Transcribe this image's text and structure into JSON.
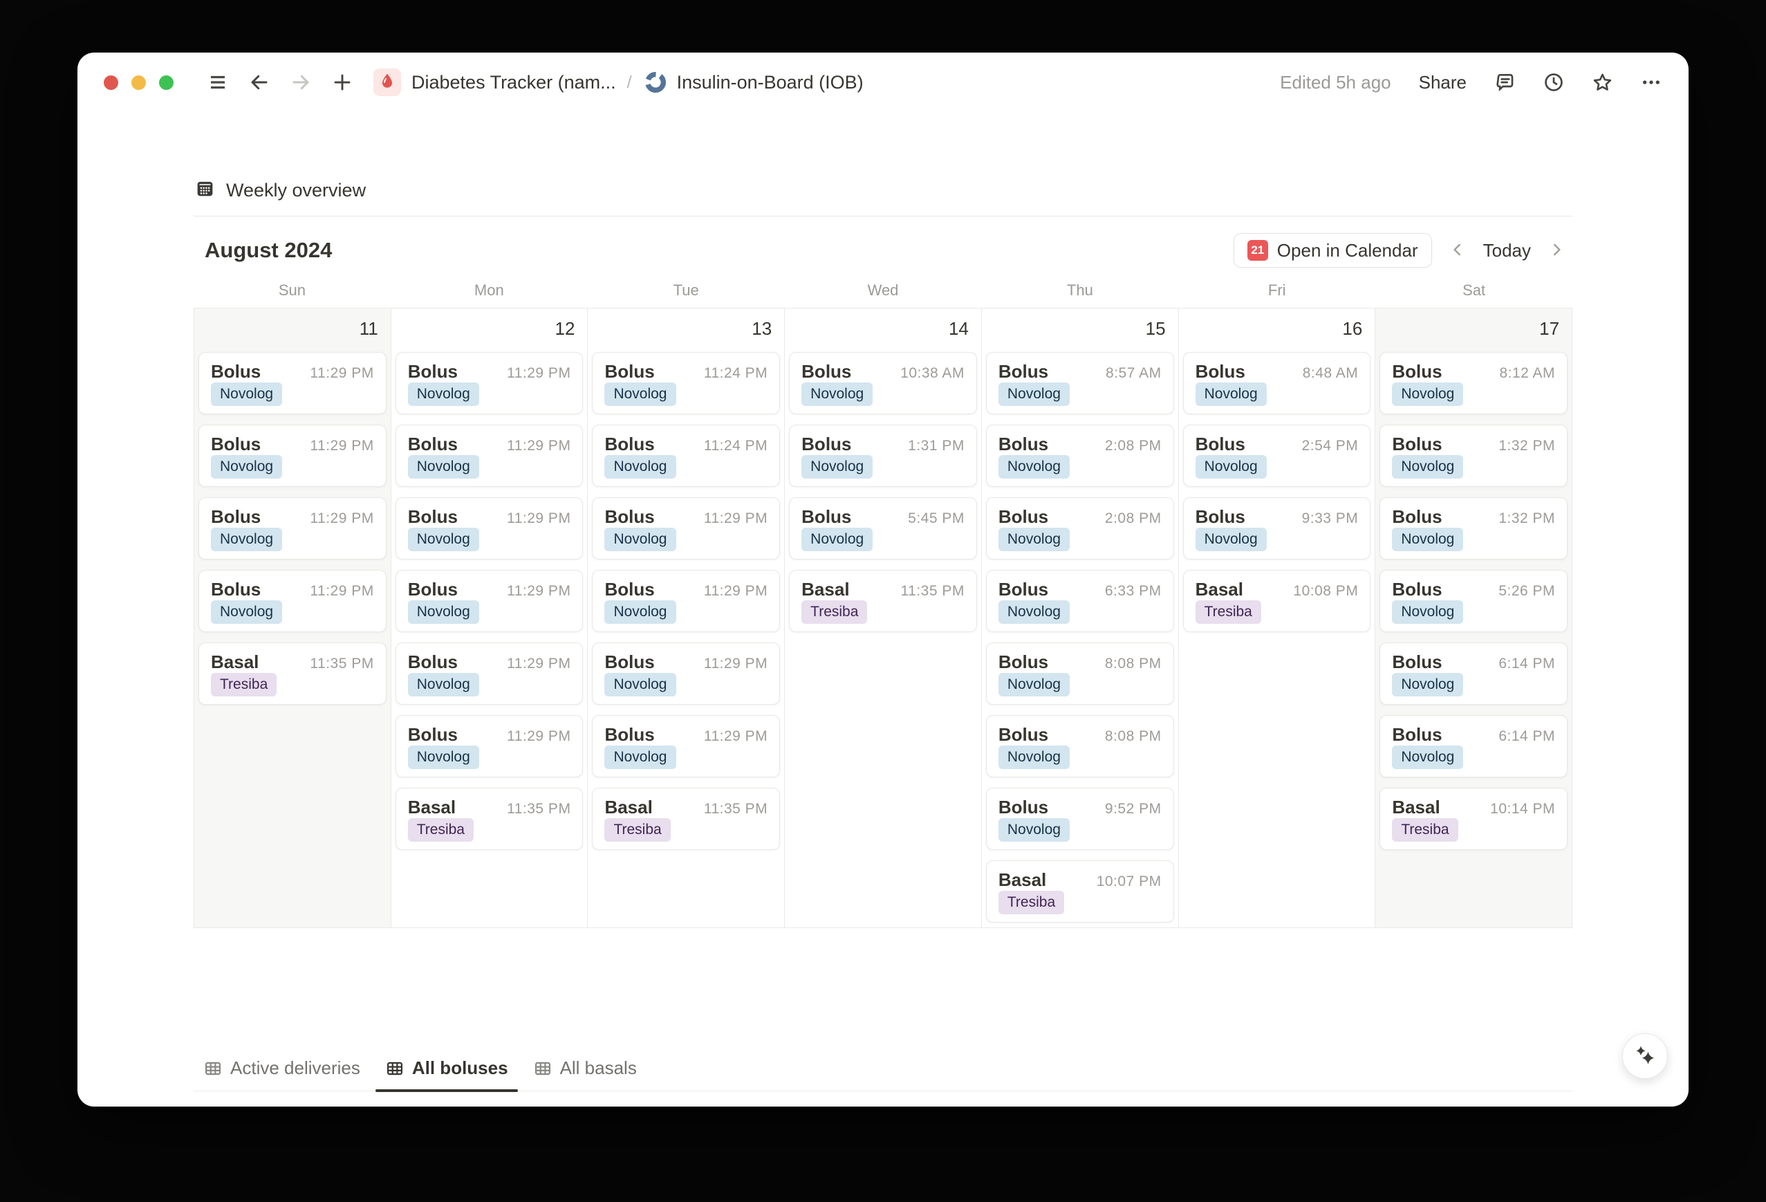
{
  "titlebar": {
    "breadcrumb": {
      "root_label": "Diabetes Tracker (nam...",
      "separator": "/",
      "page_label": "Insulin-on-Board (IOB)"
    },
    "edited": "Edited 5h ago",
    "share_label": "Share"
  },
  "view": {
    "title": "Weekly overview",
    "toolbar": {
      "month_label": "August 2024",
      "open_in_calendar_label": "Open in Calendar",
      "calendar_icon_day": "21",
      "today_label": "Today"
    }
  },
  "calendar": {
    "day_names": [
      "Sun",
      "Mon",
      "Tue",
      "Wed",
      "Thu",
      "Fri",
      "Sat"
    ],
    "days": [
      {
        "date": "11",
        "weekend": true,
        "events": [
          {
            "title": "Bolus",
            "time": "11:29 PM",
            "tag": "Novolog",
            "color": "blue"
          },
          {
            "title": "Bolus",
            "time": "11:29 PM",
            "tag": "Novolog",
            "color": "blue"
          },
          {
            "title": "Bolus",
            "time": "11:29 PM",
            "tag": "Novolog",
            "color": "blue"
          },
          {
            "title": "Bolus",
            "time": "11:29 PM",
            "tag": "Novolog",
            "color": "blue"
          },
          {
            "title": "Basal",
            "time": "11:35 PM",
            "tag": "Tresiba",
            "color": "purple"
          }
        ]
      },
      {
        "date": "12",
        "weekend": false,
        "events": [
          {
            "title": "Bolus",
            "time": "11:29 PM",
            "tag": "Novolog",
            "color": "blue"
          },
          {
            "title": "Bolus",
            "time": "11:29 PM",
            "tag": "Novolog",
            "color": "blue"
          },
          {
            "title": "Bolus",
            "time": "11:29 PM",
            "tag": "Novolog",
            "color": "blue"
          },
          {
            "title": "Bolus",
            "time": "11:29 PM",
            "tag": "Novolog",
            "color": "blue"
          },
          {
            "title": "Bolus",
            "time": "11:29 PM",
            "tag": "Novolog",
            "color": "blue"
          },
          {
            "title": "Bolus",
            "time": "11:29 PM",
            "tag": "Novolog",
            "color": "blue"
          },
          {
            "title": "Basal",
            "time": "11:35 PM",
            "tag": "Tresiba",
            "color": "purple"
          }
        ]
      },
      {
        "date": "13",
        "weekend": false,
        "events": [
          {
            "title": "Bolus",
            "time": "11:24 PM",
            "tag": "Novolog",
            "color": "blue"
          },
          {
            "title": "Bolus",
            "time": "11:24 PM",
            "tag": "Novolog",
            "color": "blue"
          },
          {
            "title": "Bolus",
            "time": "11:29 PM",
            "tag": "Novolog",
            "color": "blue"
          },
          {
            "title": "Bolus",
            "time": "11:29 PM",
            "tag": "Novolog",
            "color": "blue"
          },
          {
            "title": "Bolus",
            "time": "11:29 PM",
            "tag": "Novolog",
            "color": "blue"
          },
          {
            "title": "Bolus",
            "time": "11:29 PM",
            "tag": "Novolog",
            "color": "blue"
          },
          {
            "title": "Basal",
            "time": "11:35 PM",
            "tag": "Tresiba",
            "color": "purple"
          }
        ]
      },
      {
        "date": "14",
        "weekend": false,
        "events": [
          {
            "title": "Bolus",
            "time": "10:38 AM",
            "tag": "Novolog",
            "color": "blue"
          },
          {
            "title": "Bolus",
            "time": "1:31 PM",
            "tag": "Novolog",
            "color": "blue"
          },
          {
            "title": "Bolus",
            "time": "5:45 PM",
            "tag": "Novolog",
            "color": "blue"
          },
          {
            "title": "Basal",
            "time": "11:35 PM",
            "tag": "Tresiba",
            "color": "purple"
          }
        ]
      },
      {
        "date": "15",
        "weekend": false,
        "events": [
          {
            "title": "Bolus",
            "time": "8:57 AM",
            "tag": "Novolog",
            "color": "blue"
          },
          {
            "title": "Bolus",
            "time": "2:08 PM",
            "tag": "Novolog",
            "color": "blue"
          },
          {
            "title": "Bolus",
            "time": "2:08 PM",
            "tag": "Novolog",
            "color": "blue"
          },
          {
            "title": "Bolus",
            "time": "6:33 PM",
            "tag": "Novolog",
            "color": "blue"
          },
          {
            "title": "Bolus",
            "time": "8:08 PM",
            "tag": "Novolog",
            "color": "blue"
          },
          {
            "title": "Bolus",
            "time": "8:08 PM",
            "tag": "Novolog",
            "color": "blue"
          },
          {
            "title": "Bolus",
            "time": "9:52 PM",
            "tag": "Novolog",
            "color": "blue"
          },
          {
            "title": "Basal",
            "time": "10:07 PM",
            "tag": "Tresiba",
            "color": "purple"
          }
        ]
      },
      {
        "date": "16",
        "weekend": false,
        "events": [
          {
            "title": "Bolus",
            "time": "8:48 AM",
            "tag": "Novolog",
            "color": "blue"
          },
          {
            "title": "Bolus",
            "time": "2:54 PM",
            "tag": "Novolog",
            "color": "blue"
          },
          {
            "title": "Bolus",
            "time": "9:33 PM",
            "tag": "Novolog",
            "color": "blue"
          },
          {
            "title": "Basal",
            "time": "10:08 PM",
            "tag": "Tresiba",
            "color": "purple"
          }
        ]
      },
      {
        "date": "17",
        "weekend": true,
        "events": [
          {
            "title": "Bolus",
            "time": "8:12 AM",
            "tag": "Novolog",
            "color": "blue"
          },
          {
            "title": "Bolus",
            "time": "1:32 PM",
            "tag": "Novolog",
            "color": "blue"
          },
          {
            "title": "Bolus",
            "time": "1:32 PM",
            "tag": "Novolog",
            "color": "blue"
          },
          {
            "title": "Bolus",
            "time": "5:26 PM",
            "tag": "Novolog",
            "color": "blue"
          },
          {
            "title": "Bolus",
            "time": "6:14 PM",
            "tag": "Novolog",
            "color": "blue"
          },
          {
            "title": "Bolus",
            "time": "6:14 PM",
            "tag": "Novolog",
            "color": "blue"
          },
          {
            "title": "Basal",
            "time": "10:14 PM",
            "tag": "Tresiba",
            "color": "purple"
          }
        ]
      }
    ]
  },
  "footer": {
    "tabs": [
      {
        "label": "Active deliveries",
        "active": false
      },
      {
        "label": "All boluses",
        "active": true
      },
      {
        "label": "All basals",
        "active": false
      }
    ]
  },
  "colors": {
    "accent_red": "#EB5757",
    "tag_blue_bg": "#D3E5EF",
    "tag_blue_text": "#183347",
    "tag_purple_bg": "#E8DEEE",
    "tag_purple_text": "#412454",
    "weekend_bg": "#F7F7F5",
    "traffic_red": "#E0574D",
    "traffic_yellow": "#F3BB45",
    "traffic_green": "#3EC153"
  }
}
